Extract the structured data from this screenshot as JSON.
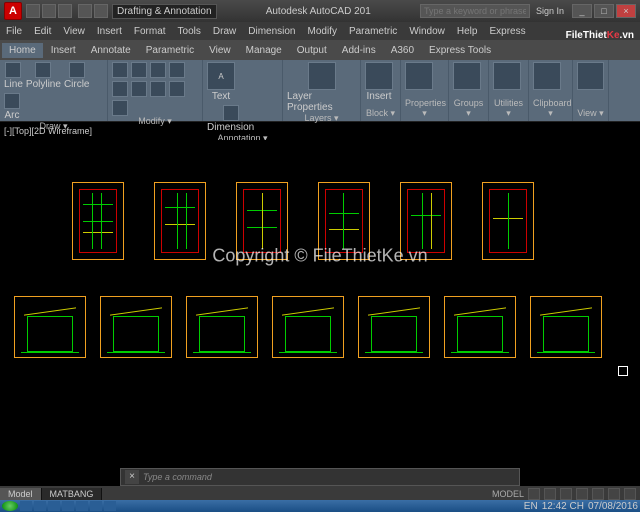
{
  "titlebar": {
    "app_letter": "A",
    "workspace": "Drafting & Annotation",
    "title": "Autodesk AutoCAD 201",
    "search_placeholder": "Type a keyword or phrase",
    "signin": "Sign In",
    "min": "_",
    "max": "□",
    "close": "×"
  },
  "menubar": [
    "File",
    "Edit",
    "View",
    "Insert",
    "Format",
    "Tools",
    "Draw",
    "Dimension",
    "Modify",
    "Parametric",
    "Window",
    "Help",
    "Express"
  ],
  "ribbon_tabs": [
    "Home",
    "Insert",
    "Annotate",
    "Parametric",
    "View",
    "Manage",
    "Output",
    "Add-ins",
    "A360",
    "Express Tools"
  ],
  "ribbon_groups": {
    "draw": {
      "title": "Draw ▾",
      "items": [
        "Line",
        "Polyline",
        "Circle",
        "Arc"
      ]
    },
    "modify": {
      "title": "Modify ▾"
    },
    "annotation": {
      "title": "Annotation ▾",
      "items": [
        "Text",
        "Dimension"
      ]
    },
    "layers": {
      "title": "Layers ▾",
      "item": "Layer Properties"
    },
    "block": {
      "title": "Block ▾",
      "item": "Insert"
    },
    "properties": {
      "title": "Properties ▾"
    },
    "groups": {
      "title": "Groups ▾"
    },
    "utilities": {
      "title": "Utilities ▾"
    },
    "clipboard": {
      "title": "Clipboard ▾"
    },
    "view": {
      "title": "View ▾"
    }
  },
  "watermark_brand1": "FileThiet",
  "watermark_brand2": "Ke",
  "watermark_brand3": ".vn",
  "viewport_label": "[-][Top][2D Wireframe]",
  "copyright": "Copyright © FileThietKe.vn",
  "command": {
    "close": "×",
    "prompt": "Type a command"
  },
  "view_tabs": [
    "Model",
    "MATBANG"
  ],
  "statusbar": {
    "model": "MODEL"
  },
  "taskbar": {
    "lang": "EN",
    "time": "12:42 CH",
    "date": "07/08/2016"
  }
}
